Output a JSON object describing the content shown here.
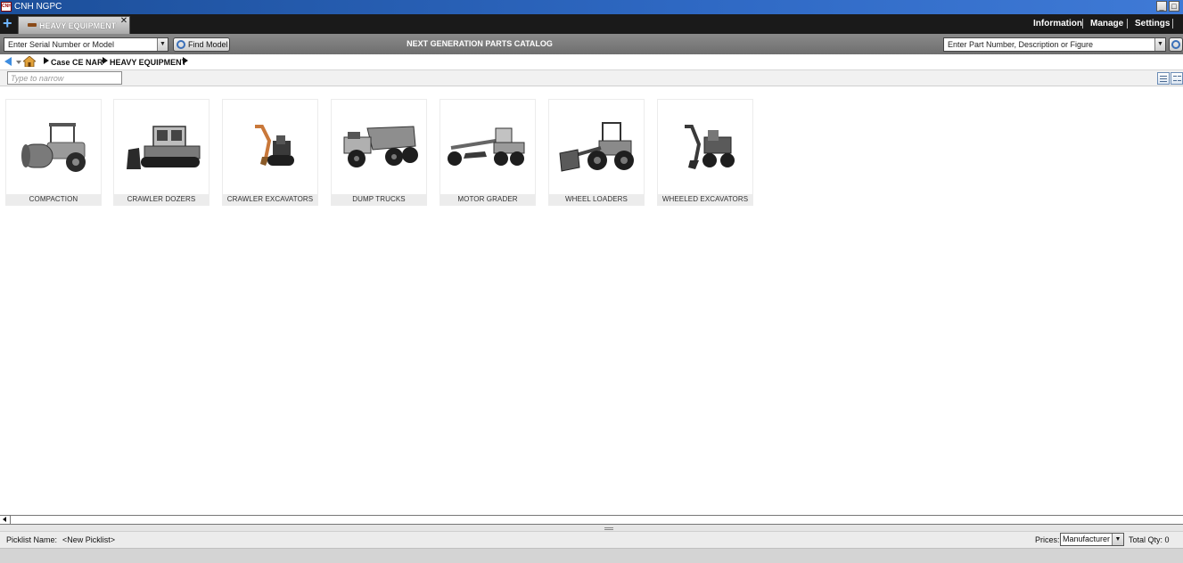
{
  "window": {
    "title": "CNH NGPC",
    "logo_text": "CNH"
  },
  "tabs": [
    {
      "label": "HEAVY EQUIPMENT"
    }
  ],
  "top_menu": {
    "information": "Information",
    "manage": "Manage",
    "settings": "Settings"
  },
  "search": {
    "serial_placeholder": "Enter Serial Number or Model",
    "find_model_label": "Find Model",
    "catalog_title": "NEXT GENERATION PARTS CATALOG",
    "part_placeholder": "Enter Part Number, Description or Figure"
  },
  "breadcrumb": {
    "items": [
      "Case CE NAR",
      "HEAVY EQUIPMENT"
    ]
  },
  "filter": {
    "placeholder": "Type to narrow"
  },
  "categories": [
    {
      "label": "COMPACTION",
      "icon": "compactor-image"
    },
    {
      "label": "CRAWLER DOZERS",
      "icon": "dozer-image"
    },
    {
      "label": "CRAWLER EXCAVATORS",
      "icon": "excavator-image"
    },
    {
      "label": "DUMP TRUCKS",
      "icon": "dump-truck-image"
    },
    {
      "label": "MOTOR GRADER",
      "icon": "grader-image"
    },
    {
      "label": "WHEEL LOADERS",
      "icon": "wheel-loader-image"
    },
    {
      "label": "WHEELED EXCAVATORS",
      "icon": "wheeled-excavator-image"
    }
  ],
  "status": {
    "picklist_label": "Picklist Name:",
    "picklist_value": "<New Picklist>",
    "prices_label": "Prices:",
    "prices_value": "Manufacturer",
    "total_qty": "Total Qty: 0"
  },
  "colors": {
    "title_bar": "#2f69c4",
    "tab_bar": "#1a1a1a",
    "search_bar": "#7a7a7a",
    "tile_label_bg": "#ececec"
  }
}
